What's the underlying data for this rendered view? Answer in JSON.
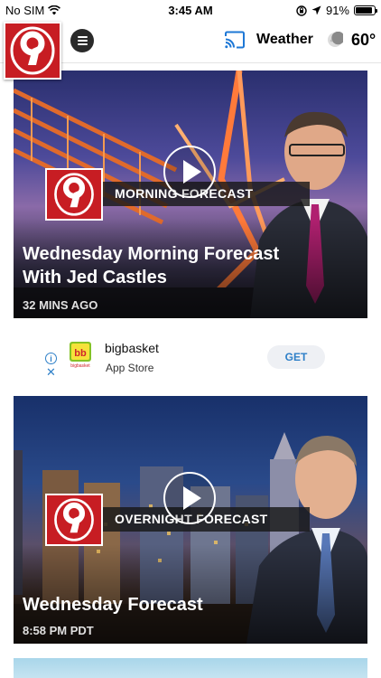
{
  "status_bar": {
    "carrier": "No SIM",
    "time": "3:45 AM",
    "battery": "91%",
    "battery_level": 0.91
  },
  "header": {
    "logo_text": "9",
    "weather_label": "Weather",
    "temperature": "60°",
    "icons": [
      "menu-icon",
      "cast-icon",
      "moon-icon"
    ]
  },
  "videos": [
    {
      "badge": "9",
      "show": "MORNING FORECAST",
      "title": "Wednesday Morning Forecast With Jed Castles",
      "time": "32 MINS AGO"
    },
    {
      "badge": "9",
      "show": "OVERNIGHT FORECAST",
      "title": "Wednesday Forecast",
      "time": "8:58 PM PDT"
    }
  ],
  "ad": {
    "app_name": "bigbasket",
    "store": "App Store",
    "cta": "GET",
    "icon_brand": "bigbasket",
    "icon_letters": "bb"
  },
  "colors": {
    "brand_red": "#c71d23",
    "ad_blue": "#2f80c8",
    "cast_blue": "#1e78d6"
  }
}
